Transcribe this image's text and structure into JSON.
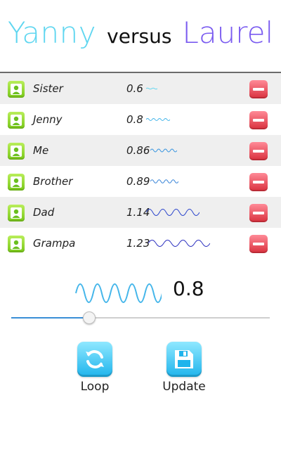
{
  "header": {
    "title_left": "Yanny",
    "title_middle": "versus",
    "title_right": "Laurel",
    "left_color": "#5fd6f0",
    "right_color": "#7a5bf0"
  },
  "people": [
    {
      "name": "Sister",
      "value": "0.6",
      "avatar_icon": "person-icon",
      "remove_icon": "minus-icon"
    },
    {
      "name": "Jenny",
      "value": "0.8",
      "avatar_icon": "person-icon",
      "remove_icon": "minus-icon"
    },
    {
      "name": "Me",
      "value": "0.86",
      "avatar_icon": "person-icon",
      "remove_icon": "minus-icon"
    },
    {
      "name": "Brother",
      "value": "0.89",
      "avatar_icon": "person-icon",
      "remove_icon": "minus-icon"
    },
    {
      "name": "Dad",
      "value": "1.14",
      "avatar_icon": "person-icon",
      "remove_icon": "minus-icon"
    },
    {
      "name": "Grampa",
      "value": "1.23",
      "avatar_icon": "person-icon",
      "remove_icon": "minus-icon"
    }
  ],
  "current": {
    "value": "0.8",
    "slider_fraction": 0.3
  },
  "actions": {
    "loop_label": "Loop",
    "loop_icon": "refresh-icon",
    "update_label": "Update",
    "update_icon": "save-icon"
  }
}
